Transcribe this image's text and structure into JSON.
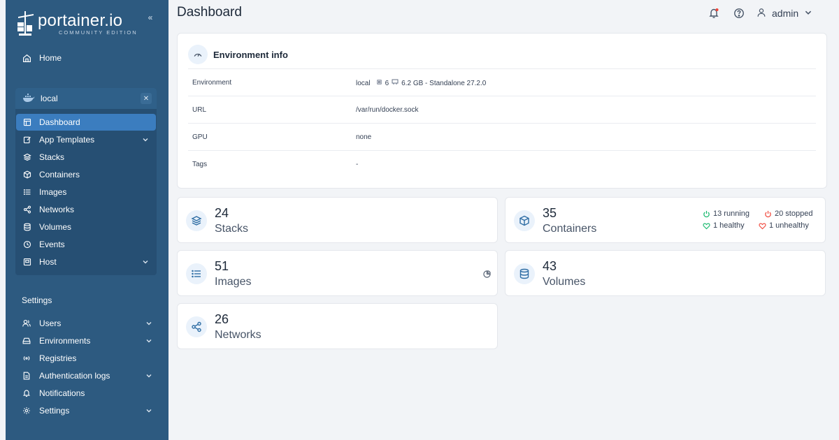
{
  "brand": {
    "name": "portainer.io",
    "subtitle": "COMMUNITY EDITION"
  },
  "sidebar": {
    "home_label": "Home",
    "environment": {
      "name": "local",
      "items": [
        {
          "label": "Dashboard",
          "icon": "dashboard-icon",
          "active": true
        },
        {
          "label": "App Templates",
          "icon": "edit-icon",
          "expandable": true
        },
        {
          "label": "Stacks",
          "icon": "layers-icon"
        },
        {
          "label": "Containers",
          "icon": "box-icon"
        },
        {
          "label": "Images",
          "icon": "list-icon"
        },
        {
          "label": "Networks",
          "icon": "share-icon"
        },
        {
          "label": "Volumes",
          "icon": "database-icon"
        },
        {
          "label": "Events",
          "icon": "clock-icon"
        },
        {
          "label": "Host",
          "icon": "server-icon",
          "expandable": true
        }
      ]
    },
    "settings_title": "Settings",
    "settings_items": [
      {
        "label": "Users",
        "icon": "user-icon",
        "expandable": true
      },
      {
        "label": "Environments",
        "icon": "hdd-icon",
        "expandable": true
      },
      {
        "label": "Registries",
        "icon": "radio-icon"
      },
      {
        "label": "Authentication logs",
        "icon": "file-icon",
        "expandable": true
      },
      {
        "label": "Notifications",
        "icon": "bell-icon"
      },
      {
        "label": "Settings",
        "icon": "gear-icon",
        "expandable": true
      }
    ]
  },
  "header": {
    "title": "Dashboard",
    "user": "admin"
  },
  "env_info": {
    "title": "Environment info",
    "rows": [
      {
        "key": "Environment",
        "value": "local",
        "cpu": "6",
        "mem": "6.2 GB - Standalone 27.2.0"
      },
      {
        "key": "URL",
        "value": "/var/run/docker.sock"
      },
      {
        "key": "GPU",
        "value": "none"
      },
      {
        "key": "Tags",
        "value": "-"
      }
    ]
  },
  "stats": {
    "stacks": {
      "count": "24",
      "label": "Stacks"
    },
    "containers": {
      "count": "35",
      "label": "Containers",
      "running": "13 running",
      "stopped": "20 stopped",
      "healthy": "1 healthy",
      "unhealthy": "1 unhealthy"
    },
    "images": {
      "count": "51",
      "label": "Images"
    },
    "volumes": {
      "count": "43",
      "label": "Volumes"
    },
    "networks": {
      "count": "26",
      "label": "Networks"
    }
  },
  "colors": {
    "sidebar": "#2d5a80",
    "active": "#3b7dbf",
    "running": "#12b76a",
    "stopped": "#f04438"
  }
}
